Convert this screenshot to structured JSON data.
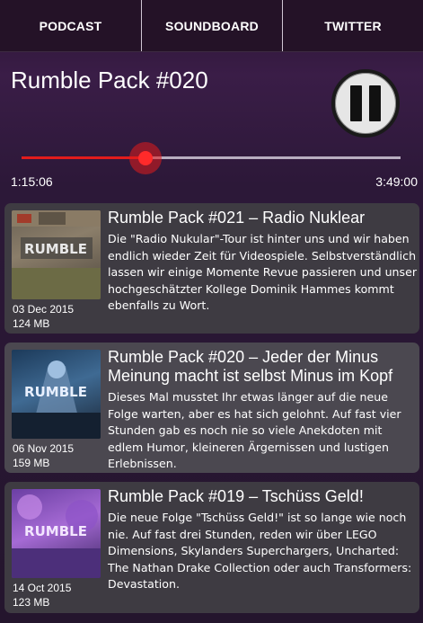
{
  "tabs": [
    {
      "label": "PODCAST"
    },
    {
      "label": "SOUNDBOARD"
    },
    {
      "label": "TWITTER"
    }
  ],
  "player": {
    "title": "Rumble Pack #020",
    "current_time": "1:15:06",
    "total_time": "3:49:00",
    "progress_fraction": 0.327,
    "pause_icon": "pause-icon",
    "accent_color": "#e21c1c"
  },
  "episodes": [
    {
      "title": "Rumble Pack #021 – Radio Nuklear",
      "description": "Die \"Radio Nukular\"-Tour ist hinter uns und wir haben endlich wieder Zeit für Videospiele. Selbstverständlich lassen wir einige Momente Revue passieren und unser hochgeschätzter Kollege Dominik Hammes kommt ebenfalls zu Wort.",
      "date": "03 Dec 2015",
      "size": "124 MB",
      "thumb_text": "RUMBLE"
    },
    {
      "title": "Rumble Pack #020 – Jeder der Minus Meinung macht ist selbst Minus im Kopf",
      "description": "Dieses Mal musstet Ihr etwas länger auf die neue Folge warten, aber es hat sich gelohnt. Auf fast vier Stunden gab es noch nie so viele Anekdoten mit edlem Humor, kleineren Ärgernissen und lustigen Erlebnissen.",
      "date": "06 Nov 2015",
      "size": "159 MB",
      "thumb_text": "RUMBLE"
    },
    {
      "title": "Rumble Pack #019 – Tschüss Geld!",
      "description": "Die neue Folge \"Tschüss Geld!\" ist so lange wie noch nie. Auf fast drei Stunden, reden wir über LEGO Dimensions, Skylanders Superchargers, Uncharted: The Nathan Drake Collection oder auch Transformers: Devastation.",
      "date": "14 Oct 2015",
      "size": "123 MB",
      "thumb_text": "RUMBLE"
    }
  ]
}
